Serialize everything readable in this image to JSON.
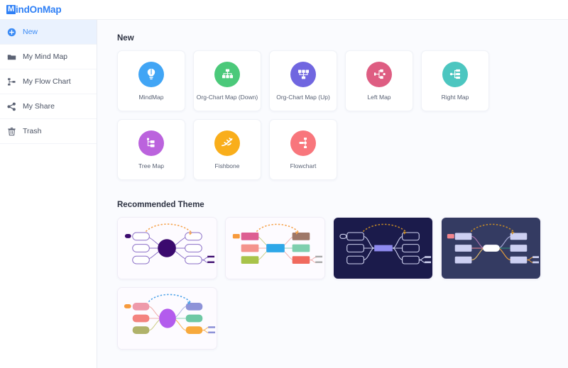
{
  "app": {
    "logo_badge": "M",
    "logo_text": "indOnMap",
    "brand_color": "#2f80f6",
    "background": "#fafbfe"
  },
  "sidebar": {
    "items": [
      {
        "label": "New",
        "icon": "plus-circle-icon",
        "active": true
      },
      {
        "label": "My Mind Map",
        "icon": "folder-icon",
        "active": false
      },
      {
        "label": "My Flow Chart",
        "icon": "flowchart-icon",
        "active": false
      },
      {
        "label": "My Share",
        "icon": "share-icon",
        "active": false
      },
      {
        "label": "Trash",
        "icon": "trash-icon",
        "active": false
      }
    ]
  },
  "main": {
    "new_section_title": "New",
    "theme_section_title": "Recommended Theme",
    "templates": [
      {
        "label": "MindMap",
        "icon": "lightbulb-icon",
        "color": "#41a5f5"
      },
      {
        "label": "Org-Chart Map (Down)",
        "icon": "org-chart-down-icon",
        "color": "#4bc97a"
      },
      {
        "label": "Org-Chart Map (Up)",
        "icon": "org-chart-up-icon",
        "color": "#7066e0"
      },
      {
        "label": "Left Map",
        "icon": "left-map-icon",
        "color": "#de5d82"
      },
      {
        "label": "Right Map",
        "icon": "right-map-icon",
        "color": "#4cc6c0"
      },
      {
        "label": "Tree Map",
        "icon": "tree-map-icon",
        "color": "#bb63dd"
      },
      {
        "label": "Fishbone",
        "icon": "fishbone-icon",
        "color": "#f9ae1b"
      },
      {
        "label": "Flowchart",
        "icon": "flowchart-round-icon",
        "color": "#f8767c"
      }
    ],
    "themes": [
      {
        "name": "theme-light-purple",
        "background": "#fdfbff",
        "center_color": "#3b0a6e",
        "center_shape": "circle",
        "node_fill": "#ffffff",
        "node_stroke": "#8b6fc7",
        "link_color": "#8b6fc7",
        "arrow_color": "#f5a24b",
        "accent_chip": "#3b0a6e"
      },
      {
        "name": "theme-light-multicolor",
        "background": "#fdfbff",
        "center_color": "#2ea7e8",
        "center_shape": "rect",
        "node_colors": [
          "#dd5e92",
          "#9e7768",
          "#f4938c",
          "#7ecfae",
          "#a8c34a",
          "#f06a5e"
        ],
        "link_color": "#c8d08a",
        "arrow_color": "#f5a24b",
        "accent_chip": "#f79a3c"
      },
      {
        "name": "theme-dark-navy",
        "background": "#1b1b4b",
        "center_color": "#8f8bf0",
        "center_shape": "rect",
        "node_fill": "#1b1b4b",
        "node_stroke": "#cfd2ef",
        "link_color": "#cfd2ef",
        "arrow_color": "#c48a28",
        "accent_chip": "#1b1b4b"
      },
      {
        "name": "theme-dark-slate",
        "background": "#343b62",
        "center_color": "#ffffff",
        "center_shape": "rect",
        "node_fill": "#cdd0f2",
        "node_stroke": "#cdd0f2",
        "link_colors": [
          "#9f6fa8",
          "#cf7b8a",
          "#2f7f76",
          "#e09a3c"
        ],
        "arrow_color": "#c48a28",
        "accent_chip": "#f2848c"
      },
      {
        "name": "theme-light-pastel",
        "background": "#fdfbff",
        "center_color": "#b35ced",
        "center_shape": "ellipse",
        "node_colors": [
          "#ee9aab",
          "#8e93d8",
          "#f4837f",
          "#6ec8a4",
          "#b0b26a",
          "#f7a93d"
        ],
        "link_color": "#f0b2b0",
        "arrow_color": "#4da3e8",
        "accent_chip": "#f79a3c"
      }
    ]
  }
}
